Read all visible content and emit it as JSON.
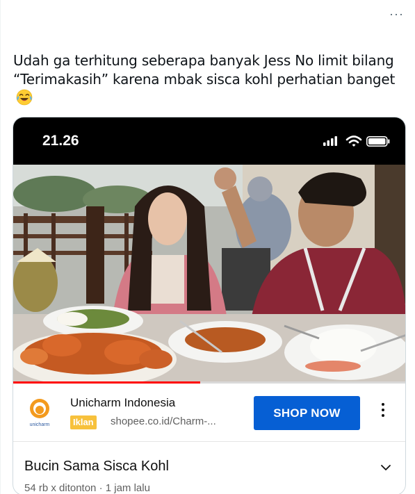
{
  "tweet": {
    "more_label": "···",
    "text": "Udah ga terhitung seberapa banyak Jess No limit bilang “Terimakasih”  karena mbak sisca kohl perhatian banget",
    "emoji": "face-with-tears-of-joy"
  },
  "statusbar": {
    "time": "21.26"
  },
  "video": {
    "progress": 0.475,
    "progress_color": "#ff0000"
  },
  "ad": {
    "advertiser": "Unicharm Indonesia",
    "logo_text": "unicharm",
    "badge": "Iklan",
    "badge_color": "#f7c13c",
    "url": "shopee.co.id/Charm-...",
    "cta": "SHOP NOW",
    "cta_color": "#065fd4"
  },
  "video_info": {
    "title": "Bucin Sama Sisca Kohl",
    "meta": "54 rb x ditonton · 1 jam lalu"
  }
}
